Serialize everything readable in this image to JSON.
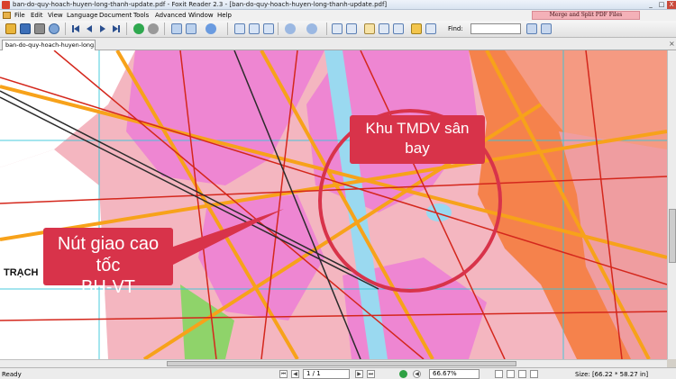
{
  "window": {
    "title": "ban-do-quy-hoach-huyen-long-thanh-update.pdf - Foxit Reader 2.3 - [ban-do-quy-hoach-huyen-long-thanh-update.pdf]",
    "promo": "Merge and Split PDF Files",
    "controls": {
      "minimize": "_",
      "maximize": "□",
      "close": "X"
    }
  },
  "menu": [
    "File",
    "Edit",
    "View",
    "Language",
    "Document",
    "Tools",
    "Advanced",
    "Window",
    "Help"
  ],
  "toolbar": {
    "find_label": "Find:",
    "find_value": ""
  },
  "tab": {
    "label": "ban-do-quy-hoach-huyen-long...",
    "close": "×"
  },
  "map": {
    "place_label": "TRẠCH",
    "callout_interchange": {
      "line1": "Nút giao cao tốc",
      "line2": "BH-VT"
    },
    "callout_airport": {
      "line1": "Khu TMDV sân",
      "line2": "bay"
    },
    "colors": {
      "urban_pink": "#f4b6c0",
      "magenta_zone": "#ee86d2",
      "orange_zone": "#f5824c",
      "salmon": "#f59a82",
      "green_zone": "#8fd36a",
      "blue_zone": "#9ad9f0",
      "road_orange": "#f7a21a",
      "road_red": "#d4271c",
      "grid_cyan": "#35c6d9",
      "annotation_red": "#d8334a"
    }
  },
  "status": {
    "ready": "Ready",
    "page": "1 / 1",
    "zoom": "66.67%",
    "size": "Size: [66.22 * 58.27 in]"
  },
  "icons": [
    "pdf-app-icon",
    "open-icon",
    "save-icon",
    "print-icon",
    "search-icon",
    "first-page-icon",
    "prev-page-icon",
    "next-page-icon",
    "last-page-icon",
    "go-back-icon",
    "go-forward-icon",
    "zoom-in-icon",
    "zoom-out-icon",
    "hand-tool-icon",
    "select-text-icon",
    "find-prev-icon",
    "find-next-icon"
  ]
}
